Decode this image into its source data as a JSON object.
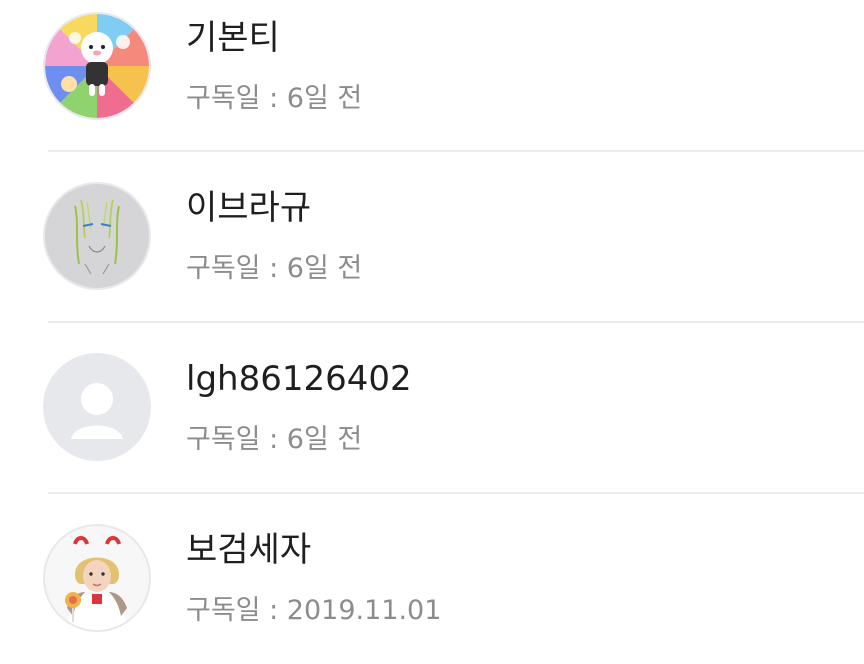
{
  "subscribers": [
    {
      "name": "기본티",
      "subscribed_label": "구독일",
      "separator": " : ",
      "subscribed_date": "6일 전",
      "avatar_icon": "colorful-character-avatar-icon"
    },
    {
      "name": "이브라규",
      "subscribed_label": "구독일",
      "separator": " : ",
      "subscribed_date": "6일 전",
      "avatar_icon": "sketch-drawing-avatar-icon"
    },
    {
      "name": "lgh86126402",
      "subscribed_label": "구독일",
      "separator": " : ",
      "subscribed_date": "6일 전",
      "avatar_icon": "default-user-avatar-icon"
    },
    {
      "name": "보검세자",
      "subscribed_label": "구독일",
      "separator": " : ",
      "subscribed_date": "2019.11.01",
      "avatar_icon": "person-photo-avatar-icon"
    }
  ],
  "colors": {
    "name_text": "#1f1f1f",
    "meta_text": "#8c8c8c",
    "divider": "#ececec",
    "default_avatar_bg": "#e6e8ec"
  }
}
